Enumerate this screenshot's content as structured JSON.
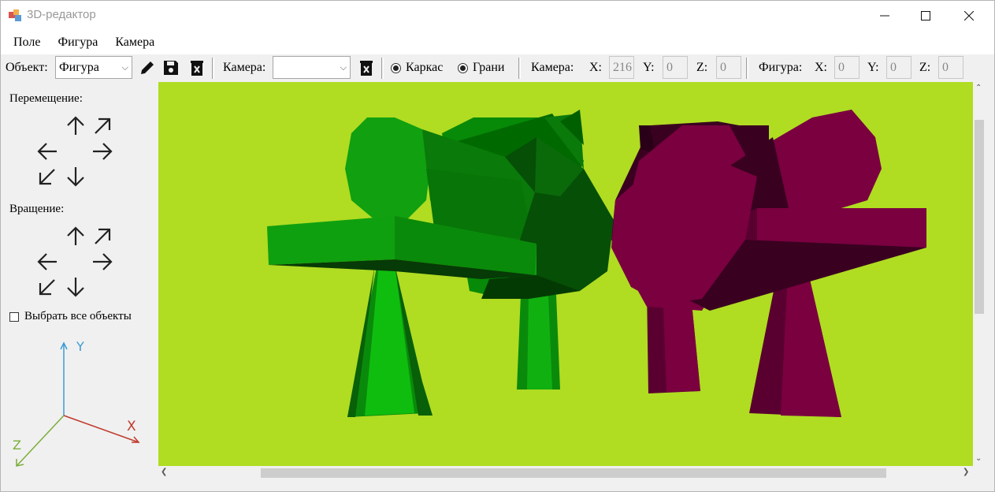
{
  "window": {
    "title": "3D-редактор",
    "min_icon": "minimize-icon",
    "max_icon": "maximize-icon",
    "close_icon": "close-icon"
  },
  "menu": {
    "items": [
      "Поле",
      "Фигура",
      "Камера"
    ]
  },
  "toolbar": {
    "object_label": "Объект:",
    "object_value": "Фигура",
    "camera_label": "Камера:",
    "camera_value": "",
    "wire_label": "Каркас",
    "faces_label": "Грани",
    "wire_selected": true,
    "faces_selected": true,
    "camera_coords_label": "Камера:",
    "figure_coords_label": "Фигура:",
    "x_label": "X:",
    "y_label": "Y:",
    "z_label": "Z:",
    "camera_x": "216",
    "camera_y": "0",
    "camera_z": "0",
    "figure_x": "0",
    "figure_y": "0",
    "figure_z": "0"
  },
  "left_panel": {
    "move_label": "Перемещение:",
    "rotate_label": "Вращение:",
    "select_all_label": "Выбрать все объекты",
    "select_all_checked": false,
    "axis_x": "X",
    "axis_y": "Y",
    "axis_z": "Z"
  },
  "colors": {
    "viewport_bg": "#b0dc22",
    "green_tree": "#0fa00f",
    "magenta_tree": "#7a0040",
    "axis_x": "#c0392b",
    "axis_y": "#3b9bd4",
    "axis_z": "#7cae3a"
  }
}
